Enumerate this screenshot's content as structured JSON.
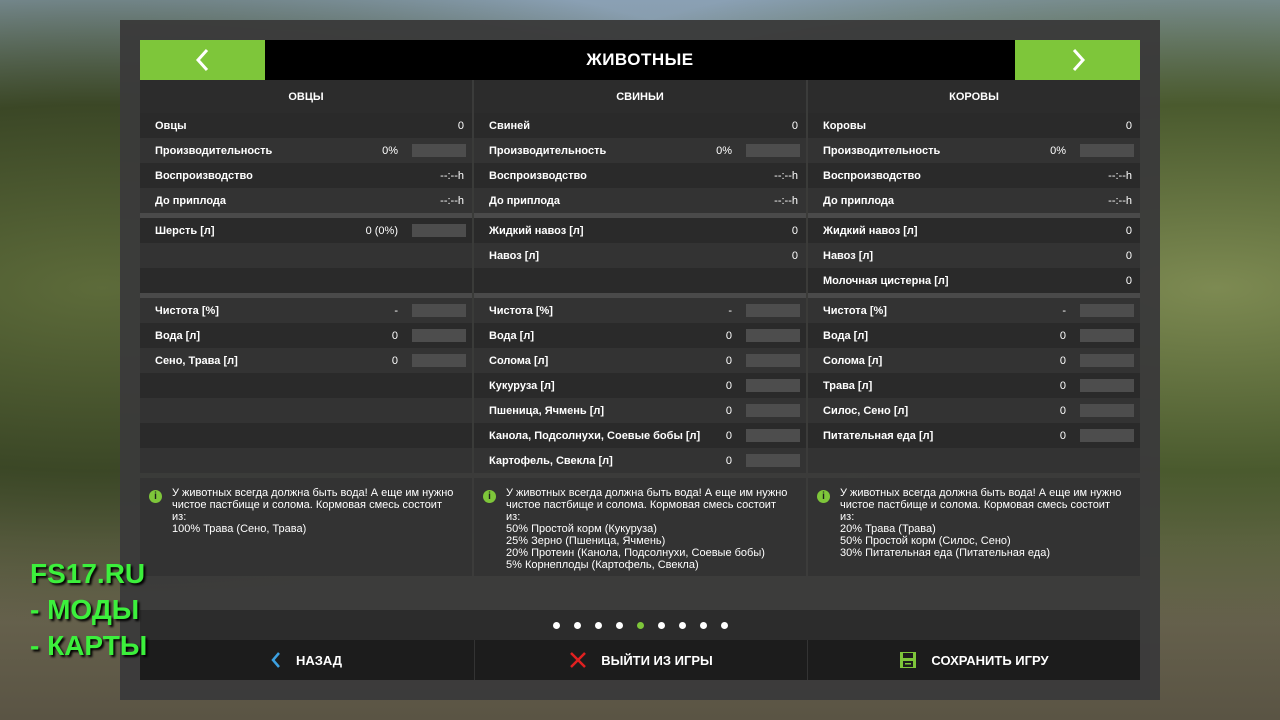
{
  "header": {
    "title": "ЖИВОТНЫЕ"
  },
  "colors": {
    "accent": "#7ec63a",
    "save_icon": "#7ec63a",
    "exit_icon": "#e02020",
    "back_icon": "#3ca0e0"
  },
  "columns": [
    {
      "title": "ОВЦЫ",
      "rows": [
        {
          "label": "Овцы",
          "value": "0",
          "bar": false
        },
        {
          "label": "Производительность",
          "value": "0%",
          "bar": true
        },
        {
          "label": "Воспроизводство",
          "value": "--:--h",
          "bar": false
        },
        {
          "label": "До приплода",
          "value": "--:--h",
          "bar": false
        },
        {
          "label": "Шерсть [л]",
          "value": "0 (0%)",
          "bar": true
        },
        {
          "label": "",
          "value": "",
          "bar": false
        },
        {
          "label": "",
          "value": "",
          "bar": false
        },
        {
          "label": "Чистота [%]",
          "value": "-",
          "bar": true
        },
        {
          "label": "Вода [л]",
          "value": "0",
          "bar": true
        },
        {
          "label": "Сено, Трава [л]",
          "value": "0",
          "bar": true
        },
        {
          "label": "",
          "value": "",
          "bar": false
        },
        {
          "label": "",
          "value": "",
          "bar": false
        },
        {
          "label": "",
          "value": "",
          "bar": false
        },
        {
          "label": "",
          "value": "",
          "bar": false
        }
      ],
      "info": "У животных всегда должна быть вода! А еще им нужно\nчистое пастбище и солома. Кормовая смесь состоит\nиз:\n100% Трава (Сено, Трава)"
    },
    {
      "title": "СВИНЬИ",
      "rows": [
        {
          "label": "Свиней",
          "value": "0",
          "bar": false
        },
        {
          "label": "Производительность",
          "value": "0%",
          "bar": true
        },
        {
          "label": "Воспроизводство",
          "value": "--:--h",
          "bar": false
        },
        {
          "label": "До приплода",
          "value": "--:--h",
          "bar": false
        },
        {
          "label": "Жидкий навоз [л]",
          "value": "0",
          "bar": false
        },
        {
          "label": "Навоз [л]",
          "value": "0",
          "bar": false
        },
        {
          "label": "",
          "value": "",
          "bar": false
        },
        {
          "label": "Чистота [%]",
          "value": "-",
          "bar": true
        },
        {
          "label": "Вода [л]",
          "value": "0",
          "bar": true
        },
        {
          "label": "Солома [л]",
          "value": "0",
          "bar": true
        },
        {
          "label": "Кукуруза [л]",
          "value": "0",
          "bar": true
        },
        {
          "label": "Пшеница, Ячмень [л]",
          "value": "0",
          "bar": true
        },
        {
          "label": "Канола, Подсолнухи, Соевые бобы [л]",
          "value": "0",
          "bar": true
        },
        {
          "label": "Картофель, Свекла [л]",
          "value": "0",
          "bar": true
        }
      ],
      "info": "У животных всегда должна быть вода! А еще им нужно\nчистое пастбище и солома. Кормовая смесь состоит\nиз:\n50% Простой корм (Кукуруза)\n25% Зерно (Пшеница, Ячмень)\n20% Протеин (Канола, Подсолнухи, Соевые бобы)\n5% Корнеплоды (Картофель, Свекла)"
    },
    {
      "title": "КОРОВЫ",
      "rows": [
        {
          "label": "Коровы",
          "value": "0",
          "bar": false
        },
        {
          "label": "Производительность",
          "value": "0%",
          "bar": true
        },
        {
          "label": "Воспроизводство",
          "value": "--:--h",
          "bar": false
        },
        {
          "label": "До приплода",
          "value": "--:--h",
          "bar": false
        },
        {
          "label": "Жидкий навоз [л]",
          "value": "0",
          "bar": false
        },
        {
          "label": "Навоз [л]",
          "value": "0",
          "bar": false
        },
        {
          "label": "Молочная цистерна [л]",
          "value": "0",
          "bar": false
        },
        {
          "label": "Чистота [%]",
          "value": "-",
          "bar": true
        },
        {
          "label": "Вода [л]",
          "value": "0",
          "bar": true
        },
        {
          "label": "Солома [л]",
          "value": "0",
          "bar": true
        },
        {
          "label": "Трава [л]",
          "value": "0",
          "bar": true
        },
        {
          "label": "Силос, Сено [л]",
          "value": "0",
          "bar": true
        },
        {
          "label": "Питательная еда [л]",
          "value": "0",
          "bar": true
        },
        {
          "label": "",
          "value": "",
          "bar": false
        }
      ],
      "info": "У животных всегда должна быть вода! А еще им нужно\nчистое пастбище и солома. Кормовая смесь состоит\nиз:\n20% Трава (Трава)\n50% Простой корм (Силос, Сено)\n30% Питательная еда (Питательная еда)"
    }
  ],
  "pagination": {
    "count": 9,
    "active": 5
  },
  "footer": {
    "back": "НАЗАД",
    "exit": "ВЫЙТИ ИЗ ИГРЫ",
    "save": "СОХРАНИТЬ ИГРУ"
  },
  "watermark": {
    "line1": "FS17.RU",
    "line2": "- МОДЫ",
    "line3": "- КАРТЫ"
  }
}
